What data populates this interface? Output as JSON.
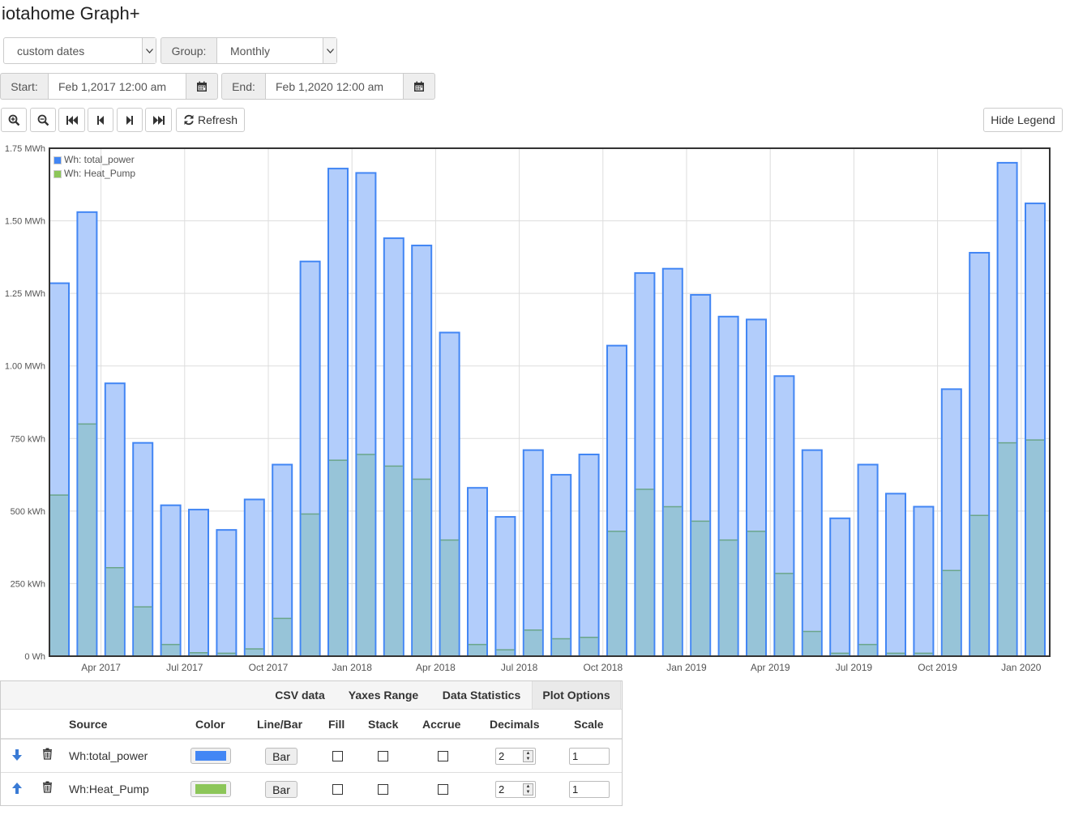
{
  "app": {
    "title": "iotahome Graph+"
  },
  "controls": {
    "range_select": "custom dates",
    "group_label": "Group:",
    "group_select": "Monthly",
    "start_label": "Start:",
    "start_value": "Feb 1,2017 12:00 am",
    "end_label": "End:",
    "end_value": "Feb 1,2020 12:00 am",
    "refresh_label": "Refresh",
    "hide_legend_label": "Hide Legend"
  },
  "icons": [
    "zoom-in-icon",
    "zoom-out-icon",
    "skip-backward-icon",
    "step-backward-icon",
    "step-forward-icon",
    "skip-forward-icon",
    "refresh-icon",
    "calendar-icon",
    "arrow-down-icon",
    "arrow-up-icon",
    "trash-icon"
  ],
  "chart_data": {
    "type": "bar",
    "categories": [
      "Feb 2017",
      "Mar 2017",
      "Apr 2017",
      "May 2017",
      "Jun 2017",
      "Jul 2017",
      "Aug 2017",
      "Sep 2017",
      "Oct 2017",
      "Nov 2017",
      "Dec 2017",
      "Jan 2018",
      "Feb 2018",
      "Mar 2018",
      "Apr 2018",
      "May 2018",
      "Jun 2018",
      "Jul 2018",
      "Aug 2018",
      "Sep 2018",
      "Oct 2018",
      "Nov 2018",
      "Dec 2018",
      "Jan 2019",
      "Feb 2019",
      "Mar 2019",
      "Apr 2019",
      "May 2019",
      "Jun 2019",
      "Jul 2019",
      "Aug 2019",
      "Sep 2019",
      "Oct 2019",
      "Nov 2019",
      "Dec 2019",
      "Jan 2020"
    ],
    "x_tick_labels": [
      "Apr 2017",
      "Jul 2017",
      "Oct 2017",
      "Jan 2018",
      "Apr 2018",
      "Jul 2018",
      "Oct 2018",
      "Jan 2019",
      "Apr 2019",
      "Jul 2019",
      "Oct 2019",
      "Jan 2020"
    ],
    "y_tick_labels": [
      "0 Wh",
      "250 kWh",
      "500 kWh",
      "750 kWh",
      "1.00 MWh",
      "1.25 MWh",
      "1.50 MWh",
      "1.75 MWh"
    ],
    "ylim": [
      0,
      1750
    ],
    "y_unit": "kWh",
    "stacked": false,
    "legend_position": "top-left",
    "grid": true,
    "series": [
      {
        "name": "Wh: total_power",
        "color": "#4286f4",
        "fill": "#b2cdfb",
        "values": [
          1285,
          1530,
          940,
          735,
          520,
          505,
          435,
          540,
          660,
          1360,
          1680,
          1665,
          1440,
          1415,
          1115,
          580,
          480,
          710,
          625,
          695,
          1070,
          1320,
          1335,
          1245,
          1170,
          1160,
          965,
          710,
          475,
          660,
          560,
          515,
          920,
          1390,
          1700,
          1560
        ]
      },
      {
        "name": "Wh: Heat_Pump",
        "color": "#8cc659",
        "fill": "#96c3d6",
        "values": [
          555,
          800,
          305,
          170,
          40,
          12,
          10,
          25,
          130,
          490,
          675,
          695,
          655,
          610,
          400,
          40,
          22,
          90,
          60,
          65,
          430,
          575,
          515,
          465,
          400,
          430,
          285,
          85,
          10,
          40,
          10,
          10,
          295,
          485,
          735,
          745
        ]
      }
    ]
  },
  "panel": {
    "tabs": [
      {
        "label": "CSV data",
        "active": false
      },
      {
        "label": "Yaxes Range",
        "active": false
      },
      {
        "label": "Data Statistics",
        "active": false
      },
      {
        "label": "Plot Options",
        "active": true
      }
    ],
    "headers": {
      "source": "Source",
      "color": "Color",
      "line_bar": "Line/Bar",
      "fill": "Fill",
      "stack": "Stack",
      "accrue": "Accrue",
      "decimals": "Decimals",
      "scale": "Scale"
    },
    "rows": [
      {
        "source": "Wh:total_power",
        "color": "#4286f4",
        "type": "Bar",
        "fill": false,
        "stack": false,
        "accrue": false,
        "decimals": "2",
        "scale": "1"
      },
      {
        "source": "Wh:Heat_Pump",
        "color": "#8cc659",
        "type": "Bar",
        "fill": false,
        "stack": false,
        "accrue": false,
        "decimals": "2",
        "scale": "1"
      }
    ]
  }
}
